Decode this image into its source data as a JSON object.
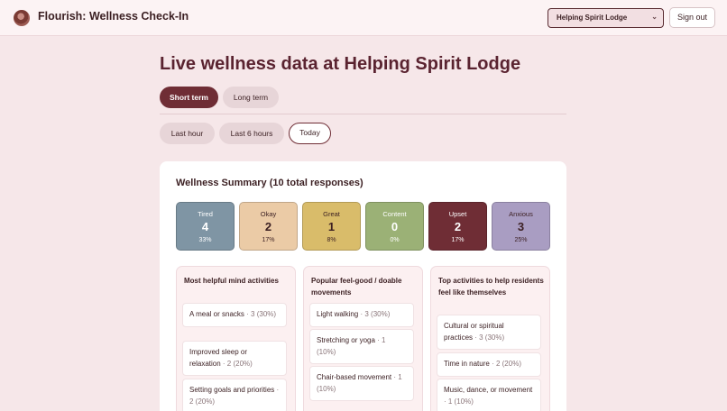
{
  "header": {
    "app_title": "Flourish: Wellness Check-In",
    "lodge_selected": "Helping Spirit Lodge",
    "signout_label": "Sign out"
  },
  "page_title": "Live wellness data at Helping Spirit Lodge",
  "term_tabs": [
    {
      "label": "Short term",
      "active": true
    },
    {
      "label": "Long term",
      "active": false
    }
  ],
  "time_filters": [
    {
      "label": "Last hour",
      "active": false
    },
    {
      "label": "Last 6 hours",
      "active": false
    },
    {
      "label": "Today",
      "active": true
    }
  ],
  "summary": {
    "title": "Wellness Summary (10 total responses)",
    "moods": [
      {
        "label": "Tired",
        "count": "4",
        "percent": "33%",
        "color": "#7f95a4",
        "text_color": "#ffffff"
      },
      {
        "label": "Okay",
        "count": "2",
        "percent": "17%",
        "color": "#ebcba6",
        "text_color": "#3b1f22"
      },
      {
        "label": "Great",
        "count": "1",
        "percent": "8%",
        "color": "#d9bc6a",
        "text_color": "#3b1f22"
      },
      {
        "label": "Content",
        "count": "0",
        "percent": "0%",
        "color": "#9bb176",
        "text_color": "#ffffff"
      },
      {
        "label": "Upset",
        "count": "2",
        "percent": "17%",
        "color": "#6f2d35",
        "text_color": "#ffffff"
      },
      {
        "label": "Anxious",
        "count": "3",
        "percent": "25%",
        "color": "#a99dc2",
        "text_color": "#3b1f22"
      }
    ]
  },
  "columns": [
    {
      "title": "Most helpful mind activities",
      "items": [
        {
          "label": "A meal or snacks",
          "meta": "· 3 (30%)"
        },
        {
          "label": "Improved sleep or relaxation",
          "meta": "· 2 (20%)"
        },
        {
          "label": "Setting goals and priorities",
          "meta": "· 2 (20%)"
        }
      ]
    },
    {
      "title": "Popular feel-good / doable movements",
      "items": [
        {
          "label": "Light walking",
          "meta": "· 3 (30%)"
        },
        {
          "label": "Stretching or yoga",
          "meta": "· 1 (10%)"
        },
        {
          "label": "Chair-based movement",
          "meta": "· 1 (10%)"
        }
      ]
    },
    {
      "title": "Top activities to help residents feel like themselves",
      "items": [
        {
          "label": "Cultural or spiritual practices",
          "meta": "· 3 (30%)"
        },
        {
          "label": "Time in nature",
          "meta": "· 2 (20%)"
        },
        {
          "label": "Music, dance, or movement",
          "meta": "· 1 (10%)"
        }
      ]
    }
  ]
}
